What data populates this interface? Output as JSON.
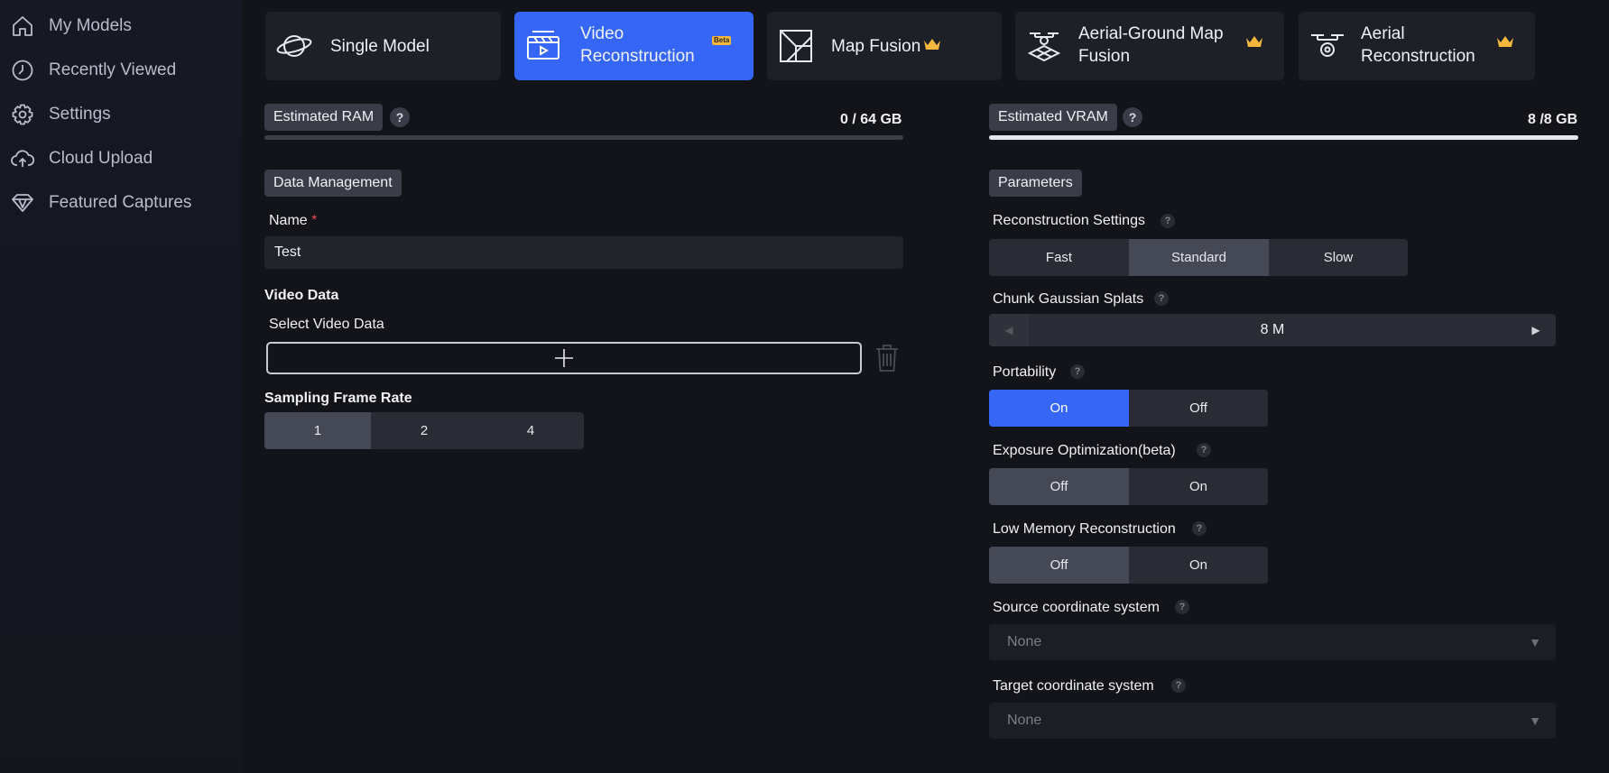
{
  "sidebar": {
    "items": [
      {
        "label": "My Models",
        "icon": "home-icon"
      },
      {
        "label": "Recently Viewed",
        "icon": "clock-icon"
      },
      {
        "label": "Settings",
        "icon": "gear-icon"
      },
      {
        "label": "Cloud Upload",
        "icon": "cloud-upload-icon"
      },
      {
        "label": "Featured Captures",
        "icon": "diamond-icon"
      }
    ]
  },
  "modes": {
    "single_model": "Single Model",
    "video_recon_line1": "Video",
    "video_recon_line2": "Reconstruction",
    "video_badge": "Beta",
    "map_fusion": "Map Fusion",
    "aerial_ground_line1": "Aerial-Ground Map",
    "aerial_ground_line2": "Fusion",
    "aerial_recon_line1": "Aerial",
    "aerial_recon_line2": "Reconstruction",
    "active": "Video Reconstruction"
  },
  "left_panel": {
    "ram_chip": "Estimated RAM",
    "ram_value": "0 / 64 GB",
    "ram_fraction": 0.0,
    "data_chip": "Data Management",
    "name_label": "Name",
    "name_required": "*",
    "name_value": "Test",
    "video_data_heading": "Video Data",
    "select_video_label": "Select Video Data",
    "frame_rate_heading": "Sampling Frame Rate",
    "frame_rate_options": [
      "1",
      "2",
      "4"
    ],
    "frame_rate_selected": "1"
  },
  "right_panel": {
    "vram_chip": "Estimated VRAM",
    "vram_value": "8 /8 GB",
    "vram_fraction": 1.0,
    "params_chip": "Parameters",
    "recon_settings_label": "Reconstruction Settings",
    "recon_settings_options": [
      "Fast",
      "Standard",
      "Slow"
    ],
    "recon_settings_selected": "Standard",
    "chunk_label": "Chunk Gaussian Splats",
    "chunk_value": "8 M",
    "portability_label": "Portability",
    "portability_options": [
      "On",
      "Off"
    ],
    "portability_selected": "On",
    "exposure_label": "Exposure Optimization(beta)",
    "exposure_options": [
      "Off",
      "On"
    ],
    "exposure_selected": "Off",
    "lowmem_label": "Low Memory Reconstruction",
    "lowmem_options": [
      "Off",
      "On"
    ],
    "lowmem_selected": "Off",
    "source_cs_label": "Source coordinate system",
    "source_cs_value": "None",
    "target_cs_label": "Target coordinate system",
    "target_cs_value": "None"
  },
  "help_glyph": "?",
  "colors": {
    "accent": "#3566f6",
    "crown": "#f5b73c",
    "required": "#e04a52",
    "background": "#13141a"
  }
}
